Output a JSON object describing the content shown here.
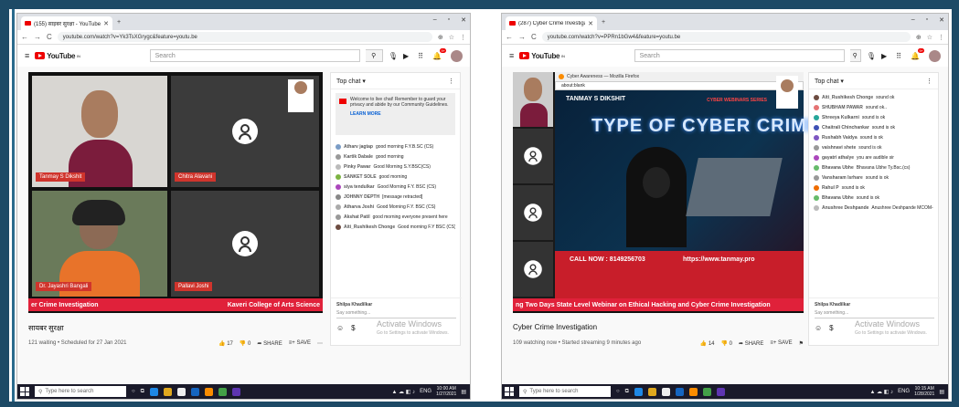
{
  "left": {
    "tab_title": "(155) साइबर सुरक्षा - YouTube",
    "url": "youtube.com/watch?v=Yk3TsXGrygc&feature=youtu.be",
    "search_placeholder": "Search",
    "participants": [
      "Tanmay S Dikshit",
      "Chitra Alavani",
      "Dr. Jayashri Bangali",
      "Pallavi Joshi"
    ],
    "ticker_left": "er Crime Investigation",
    "ticker_right": "Kaveri College of Arts Science",
    "video_title": "सायबर सुरक्षा",
    "meta": "121 waiting • Scheduled for 27 Jan 2021",
    "likes": "17",
    "dislikes": "0",
    "share": "SHARE",
    "save": "SAVE",
    "chat_header": "Top chat",
    "pinned_text": "Welcome to live chat! Remember to guard your privacy and abide by our Community Guidelines.",
    "learn_more": "LEARN MORE",
    "messages": [
      {
        "user": "Atharv jagtap",
        "text": "good morning F.Y.B.SC (CS)",
        "color": "#7a9cc6"
      },
      {
        "user": "Kartik Dabale",
        "text": "good morning",
        "color": "#999"
      },
      {
        "user": "Pinky Pawar",
        "text": "Good Morning S.Y.BSC(CS)",
        "color": "#bbb"
      },
      {
        "user": "SANKET SOLE",
        "text": "good morning",
        "color": "#7cb342"
      },
      {
        "user": "siya tendulkar",
        "text": "Good Morning F.Y. BSC (CS)",
        "color": "#ab47bc"
      },
      {
        "user": "JOHNNY DEPTH",
        "text": "[message retracted]",
        "color": "#888"
      },
      {
        "user": "Atharva Joshi",
        "text": "Good Morning F.Y. BSC (CS)",
        "color": "#aaa"
      },
      {
        "user": "Akshat Patil",
        "text": "good morning everyone present here",
        "color": "#999"
      },
      {
        "user": "Aiti_Rushikesh Chonge",
        "text": "Good morning F.Y BSC (CS)",
        "color": "#6d4c41"
      }
    ],
    "chat_user": "Shilpa Khadilkar",
    "say_something": "Say something...",
    "activate_title": "Activate Windows",
    "activate_sub": "Go to Settings to activate Windows.",
    "taskbar_search": "Type here to search",
    "time": "10:00 AM",
    "date": "1/27/2021",
    "lang": "ENG"
  },
  "right": {
    "tab_title": "(287) Cyber Crime Investigat",
    "url": "youtube.com/watch?v=PPRn1bGw4&feature=youtu.be",
    "search_placeholder": "Search",
    "firefox_title": "Cyber Awareness — Mozilla Firefox",
    "firefox_url": "about:blank",
    "presenter": "TANMAY S DIKSHIT",
    "series": "CYBER WEBINARS SERIES",
    "banner": "TYPE OF CYBER CRIME",
    "call": "CALL NOW : 8149256703",
    "site": "https://www.tanmay.pro",
    "ticker": "ng Two Days State Level Webinar on Ethical Hacking and Cyber Crime Investigation",
    "video_title": "Cyber Crime Investigation",
    "meta": "109 watching now • Started streaming 9 minutes ago",
    "likes": "14",
    "dislikes": "0",
    "share": "SHARE",
    "save": "SAVE",
    "chat_header": "Top chat",
    "messages": [
      {
        "user": "Aiti_Rushikesh Chonge",
        "text": "sound ok",
        "color": "#6d4c41"
      },
      {
        "user": "SHUBHAM PAWAR",
        "text": "sound ok..",
        "color": "#e57373"
      },
      {
        "user": "Shreeya Kulkarni",
        "text": "sound is ok",
        "color": "#26a69a"
      },
      {
        "user": "Chaitrali Chinchankar",
        "text": "sound is ok",
        "color": "#3f51b5"
      },
      {
        "user": "Rushabh Vaidya",
        "text": "sound is ok",
        "color": "#7e57c2"
      },
      {
        "user": "vaishnavi shete",
        "text": "sound is ok",
        "color": "#999"
      },
      {
        "user": "gayatri athalye",
        "text": "you are audible sir",
        "color": "#ab47bc"
      },
      {
        "user": "Bhavana Ubhe",
        "text": "Bhavana Ubhe Ty.Bsc.(cs)",
        "color": "#66bb6a"
      },
      {
        "user": "Vansharam Isrhare",
        "text": "sound is ok",
        "color": "#999"
      },
      {
        "user": "Rahul P",
        "text": "sound is ok",
        "color": "#ef6c00"
      },
      {
        "user": "Bhavana Ubhe",
        "text": "sound is ok",
        "color": "#66bb6a"
      },
      {
        "user": "Anushree Deshpande",
        "text": "Anushree Deshpande MCOM-I",
        "color": "#bbb"
      }
    ],
    "chat_user": "Shilpa Khadilkar",
    "say_something": "Say something...",
    "activate_title": "Activate Windows",
    "activate_sub": "Go to Settings to activate Windows.",
    "taskbar_search": "Type here to search",
    "time": "10:15 AM",
    "date": "1/28/2021",
    "lang": "ENG"
  }
}
